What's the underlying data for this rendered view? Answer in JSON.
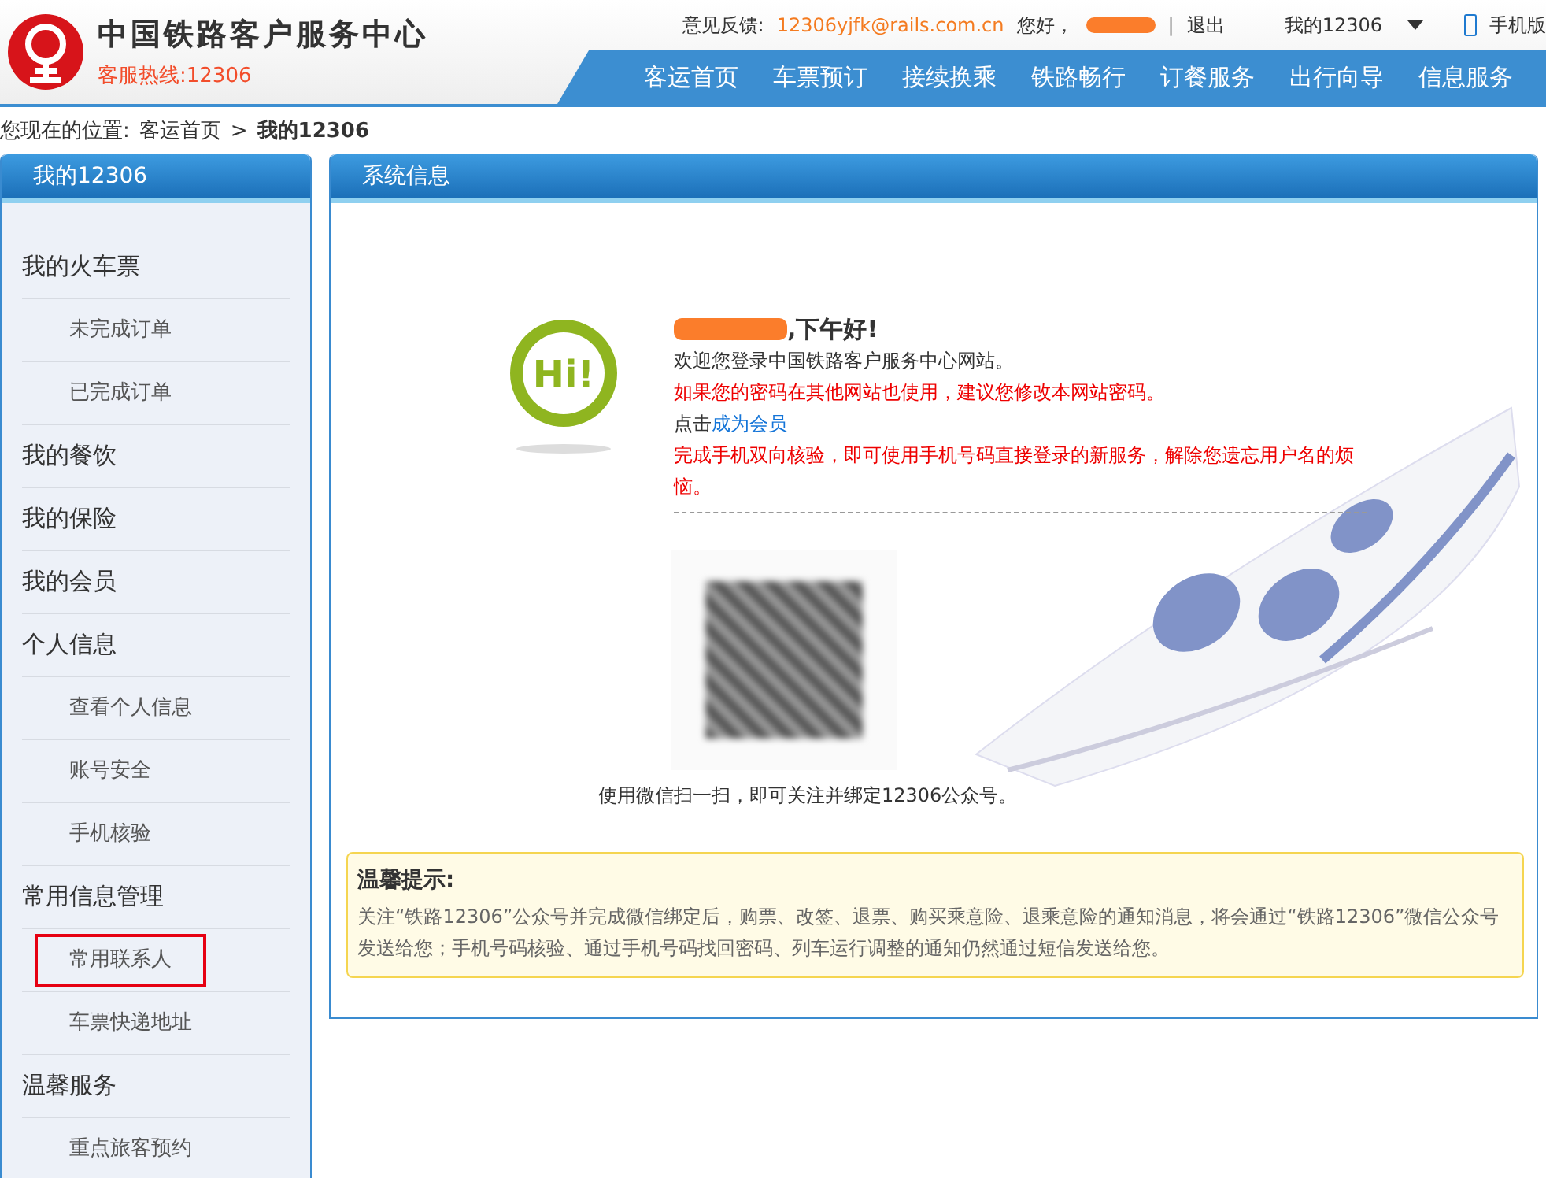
{
  "header": {
    "title": "中国铁路客户服务中心",
    "hotline": "客服热线:12306",
    "feedback_label": "意见反馈:",
    "feedback_email": "12306yjfk@rails.com.cn",
    "greeting": "您好，",
    "separator": "|",
    "logout": "退出",
    "my_menu": "我的12306",
    "mobile": "手机版"
  },
  "nav": [
    {
      "label": "客运首页"
    },
    {
      "label": "车票预订"
    },
    {
      "label": "接续换乘"
    },
    {
      "label": "铁路畅行"
    },
    {
      "label": "订餐服务"
    },
    {
      "label": "出行向导"
    },
    {
      "label": "信息服务"
    }
  ],
  "breadcrumb": {
    "label": "您现在的位置:",
    "home": "客运首页",
    "separator": ">",
    "current": "我的12306"
  },
  "sidebar": {
    "title": "我的12306",
    "items": [
      {
        "label": "我的火车票",
        "children": [
          {
            "label": "未完成订单",
            "highlighted": false
          },
          {
            "label": "已完成订单",
            "highlighted": false
          }
        ]
      },
      {
        "label": "我的餐饮"
      },
      {
        "label": "我的保险"
      },
      {
        "label": "我的会员"
      },
      {
        "label": "个人信息",
        "children": [
          {
            "label": "查看个人信息",
            "highlighted": false
          },
          {
            "label": "账号安全",
            "highlighted": false
          },
          {
            "label": "手机核验",
            "highlighted": false
          }
        ]
      },
      {
        "label": "常用信息管理",
        "children": [
          {
            "label": "常用联系人",
            "highlighted": true
          },
          {
            "label": "车票快递地址",
            "highlighted": false
          }
        ]
      },
      {
        "label": "温馨服务",
        "children": [
          {
            "label": "重点旅客预约",
            "highlighted": false
          }
        ]
      }
    ]
  },
  "panel": {
    "title": "系统信息",
    "badge": "Hi!",
    "greeting": ",下午好!",
    "welcome": "欢迎您登录中国铁路客户服务中心网站。",
    "password_warning": "如果您的密码在其他网站也使用，建议您修改本网站密码。",
    "member_prefix": "点击",
    "member_link": "成为会员",
    "verify_notice": "完成手机双向核验，即可使用手机号码直接登录的新服务，解除您遗忘用户名的烦恼。",
    "qr_caption": "使用微信扫一扫，即可关注并绑定12306公众号。"
  },
  "tip": {
    "title": "温馨提示:",
    "text": "关注“铁路12306”公众号并完成微信绑定后，购票、改签、退票、购买乘意险、退乘意险的通知消息，将会通过“铁路12306”微信公众号发送给您；手机号码核验、通过手机号码找回密码、列车运行调整的通知仍然通过短信发送给您。"
  }
}
